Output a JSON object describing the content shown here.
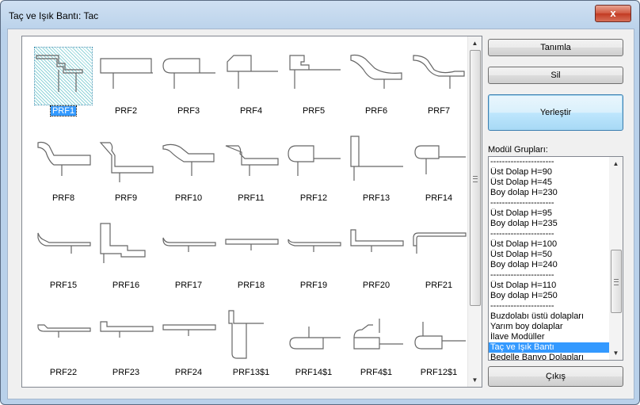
{
  "window": {
    "title": "Taç ve Işık Bantı:  Tac",
    "close_glyph": "x"
  },
  "profiles": [
    {
      "label": "PRF1",
      "selected": true
    },
    {
      "label": "PRF2"
    },
    {
      "label": "PRF3"
    },
    {
      "label": "PRF4"
    },
    {
      "label": "PRF5"
    },
    {
      "label": "PRF6"
    },
    {
      "label": "PRF7"
    },
    {
      "label": "PRF8"
    },
    {
      "label": "PRF9"
    },
    {
      "label": "PRF10"
    },
    {
      "label": "PRF11"
    },
    {
      "label": "PRF12"
    },
    {
      "label": "PRF13"
    },
    {
      "label": "PRF14"
    },
    {
      "label": "PRF15"
    },
    {
      "label": "PRF16"
    },
    {
      "label": "PRF17"
    },
    {
      "label": "PRF18"
    },
    {
      "label": "PRF19"
    },
    {
      "label": "PRF20"
    },
    {
      "label": "PRF21"
    },
    {
      "label": "PRF22"
    },
    {
      "label": "PRF23"
    },
    {
      "label": "PRF24"
    },
    {
      "label": "PRF13$1"
    },
    {
      "label": "PRF14$1"
    },
    {
      "label": "PRF4$1"
    },
    {
      "label": "PRF12$1"
    }
  ],
  "buttons": {
    "define": "Tanımla",
    "delete": "Sil",
    "place": "Yerleştir",
    "exit": "Çıkış"
  },
  "module_groups": {
    "label": "Modül Grupları:",
    "items": [
      "----------------------",
      "Üst Dolap H=90",
      "Üst Dolap H=45",
      "Boy dolap H=230",
      "----------------------",
      "Üst Dolap H=95",
      "Boy dolap H=235",
      "----------------------",
      "Üst Dolap H=100",
      "Üst Dolap H=50",
      "Boy dolap H=240",
      "----------------------",
      "Üst Dolap H=110",
      "Boy dolap H=250",
      "----------------------",
      "Buzdolabı üstü dolapları",
      "Yarım boy dolaplar",
      "İlave Modüller",
      "Taç ve Işık Bantı",
      "Bedelle Banyo Dolapları"
    ],
    "selected_item": "Taç ve Işık Bantı"
  }
}
